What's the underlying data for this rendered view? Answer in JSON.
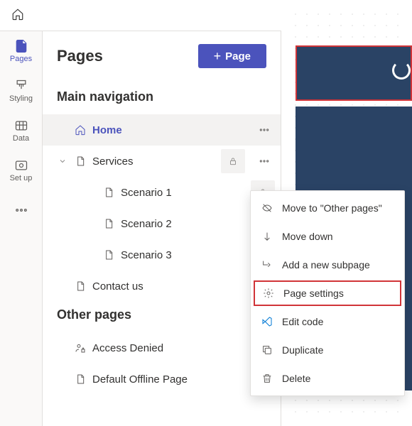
{
  "rail": {
    "items": [
      {
        "label": "Pages",
        "active": true
      },
      {
        "label": "Styling"
      },
      {
        "label": "Data"
      },
      {
        "label": "Set up"
      }
    ]
  },
  "panel": {
    "title": "Pages",
    "addButton": "Page",
    "sections": {
      "main": "Main navigation",
      "other": "Other pages"
    }
  },
  "tree": {
    "home": "Home",
    "services": "Services",
    "scenario1": "Scenario 1",
    "scenario2": "Scenario 2",
    "scenario3": "Scenario 3",
    "contact": "Contact us",
    "accessDenied": "Access Denied",
    "defaultOffline": "Default Offline Page"
  },
  "menu": {
    "moveTo": "Move to \"Other pages\"",
    "moveDown": "Move down",
    "addSubpage": "Add a new subpage",
    "pageSettings": "Page settings",
    "editCode": "Edit code",
    "duplicate": "Duplicate",
    "delete": "Delete"
  }
}
